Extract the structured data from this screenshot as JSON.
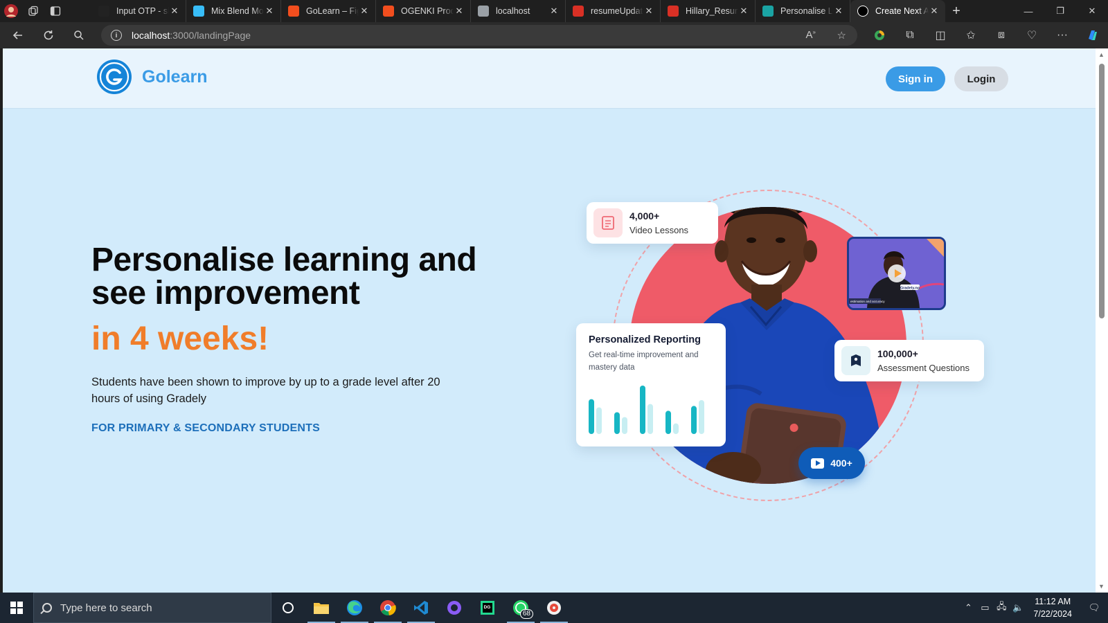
{
  "browser": {
    "tabs": [
      {
        "title": "Input OTP - shadcn",
        "icon": "shadcn-icon",
        "color": "#222222"
      },
      {
        "title": "Mix Blend Mode",
        "icon": "tailwind-icon",
        "color": "#38bdf8"
      },
      {
        "title": "GoLearn – Figma",
        "icon": "figma-icon",
        "color": "#f24e1e"
      },
      {
        "title": "OGENKI Product",
        "icon": "figma-icon",
        "color": "#f24e1e"
      },
      {
        "title": "localhost",
        "icon": "page-icon",
        "color": "#9aa0a6"
      },
      {
        "title": "resumeUpdate",
        "icon": "pdf-icon",
        "color": "#d93025"
      },
      {
        "title": "Hillary_Resume",
        "icon": "pdf-icon",
        "color": "#d93025"
      },
      {
        "title": "Personalise Learning",
        "icon": "golearn-icon",
        "color": "#1aa3a3"
      },
      {
        "title": "Create Next App",
        "icon": "nextjs-icon",
        "color": "#ffffff",
        "active": true
      }
    ],
    "url_host": "localhost",
    "url_path": ":3000/landingPage"
  },
  "header": {
    "brand": "Golearn",
    "signin_label": "Sign in",
    "login_label": "Login"
  },
  "hero": {
    "headline": "Personalise learning and see improvement",
    "headline_accent": "in 4 weeks!",
    "lead": "Students have been shown to improve by up to a grade level after 20 hours of using Gradely",
    "eyebrow": "FOR PRIMARY & SECONDARY STUDENTS"
  },
  "stats": {
    "lessons_count": "4,000+",
    "lessons_label": "Video Lessons",
    "questions_count": "100,000+",
    "questions_label": "Assessment Questions",
    "videos_count": "400+"
  },
  "report": {
    "title": "Personalized Reporting",
    "desc": "Get real-time improvement and mastery data",
    "bar_pairs": [
      [
        0.72,
        0.55
      ],
      [
        0.45,
        0.35
      ],
      [
        1.0,
        0.62
      ],
      [
        0.48,
        0.22
      ],
      [
        0.58,
        0.7
      ]
    ],
    "colors": {
      "primary": "#17b6c4",
      "secondary": "#c7eef2"
    }
  },
  "video_card": {
    "banner": "Gradely.ng",
    "caption": "estimation and accuracy"
  },
  "colors": {
    "page_bg": "#d2ebfb",
    "brand": "#3a9be6",
    "accent": "#f07d2a",
    "eyebrow": "#1d6fba",
    "disc": "#ef5b68"
  },
  "taskbar": {
    "search_placeholder": "Type here to search",
    "whatsapp_badge": "68",
    "time": "11:12 AM",
    "date": "7/22/2024"
  }
}
